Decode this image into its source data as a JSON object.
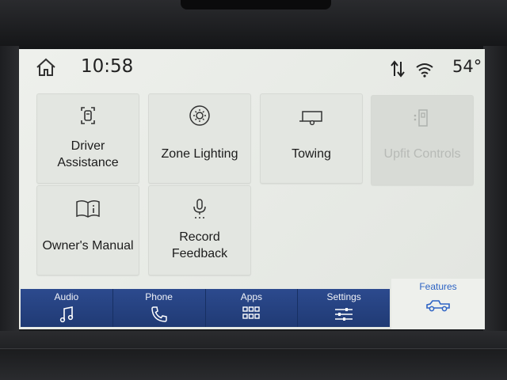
{
  "status_bar": {
    "time": "10:58",
    "temperature": "54°",
    "icons": [
      "home-icon",
      "sync-arrows-icon",
      "wifi-icon"
    ]
  },
  "tiles": [
    {
      "label": "Driver\nAssistance",
      "icon": "driver-assist-icon",
      "enabled": true
    },
    {
      "label": "Zone Lighting",
      "icon": "zone-lighting-icon",
      "enabled": true
    },
    {
      "label": "Towing",
      "icon": "trailer-icon",
      "enabled": true
    },
    {
      "label": "Upfit Controls",
      "icon": "upfit-icon",
      "enabled": false
    },
    {
      "label": "Owner's Manual",
      "icon": "book-icon",
      "enabled": true
    },
    {
      "label": "Record\nFeedback",
      "icon": "microphone-icon",
      "enabled": true
    }
  ],
  "nav": {
    "items": [
      {
        "label": "Audio",
        "icon": "music-note-icon"
      },
      {
        "label": "Phone",
        "icon": "phone-icon"
      },
      {
        "label": "Apps",
        "icon": "apps-grid-icon"
      },
      {
        "label": "Settings",
        "icon": "sliders-icon"
      }
    ],
    "active": {
      "label": "Features",
      "icon": "truck-icon"
    }
  },
  "colors": {
    "nav_bg": "#2a4689",
    "active_text": "#2d63c4",
    "screen_bg": "#e8ebe6"
  }
}
